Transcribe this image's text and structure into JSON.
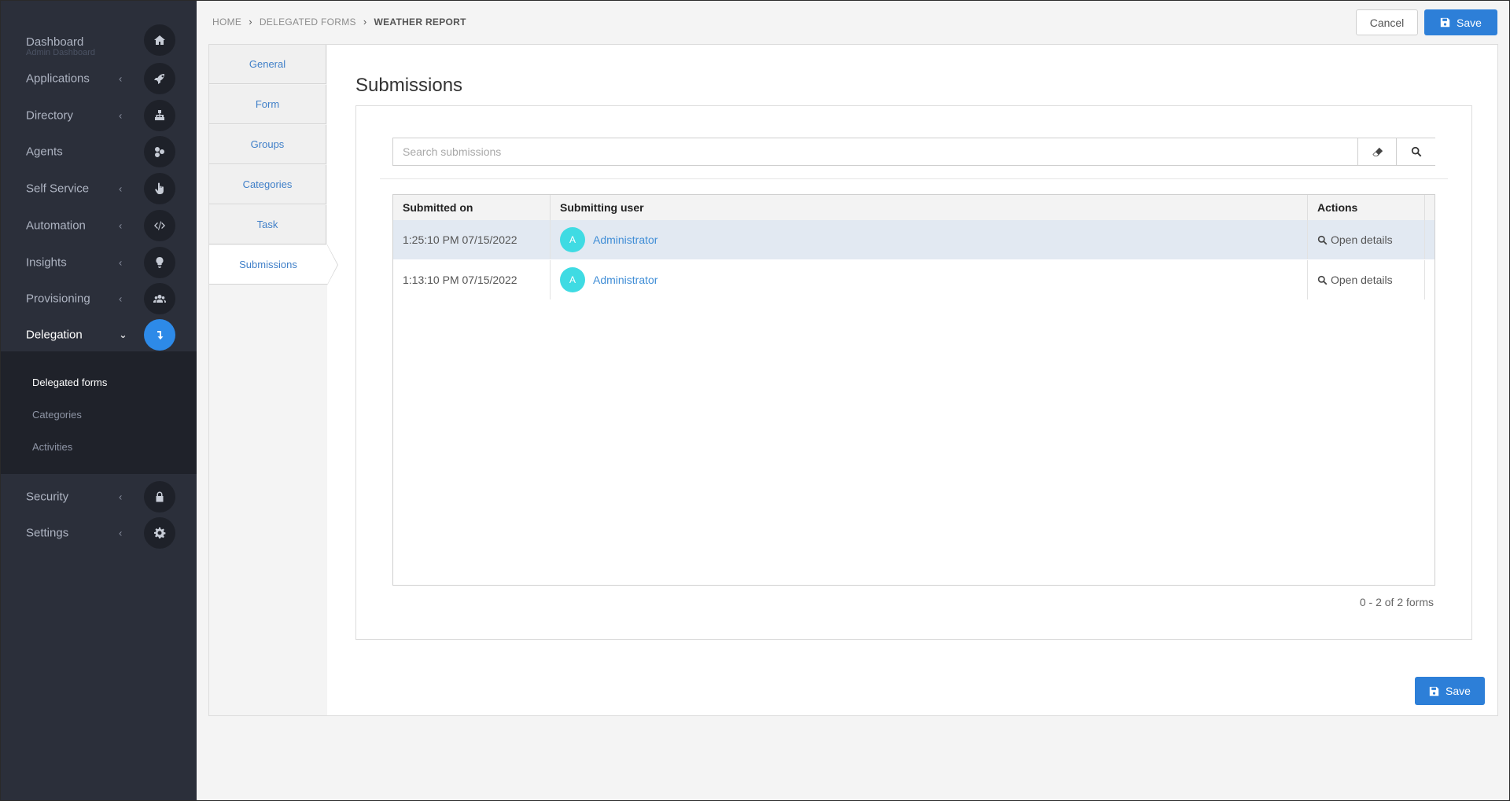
{
  "sidebar": {
    "items": [
      {
        "label": "Dashboard",
        "sub": "Admin Dashboard",
        "icon": "home-icon"
      },
      {
        "label": "Applications",
        "icon": "rocket-icon"
      },
      {
        "label": "Directory",
        "icon": "org-chart-icon"
      },
      {
        "label": "Agents",
        "icon": "agents-icon"
      },
      {
        "label": "Self Service",
        "icon": "hand-pointer-icon"
      },
      {
        "label": "Automation",
        "icon": "code-icon"
      },
      {
        "label": "Insights",
        "icon": "lightbulb-icon"
      },
      {
        "label": "Provisioning",
        "icon": "users-icon"
      },
      {
        "label": "Delegation",
        "icon": "level-down-icon"
      },
      {
        "label": "Security",
        "icon": "lock-icon"
      },
      {
        "label": "Settings",
        "icon": "gear-icon"
      }
    ],
    "subitems": [
      "Delegated forms",
      "Categories",
      "Activities"
    ],
    "chevron_left": "‹",
    "chevron_down": "⌄"
  },
  "header": {
    "breadcrumb": [
      "HOME",
      "DELEGATED FORMS",
      "WEATHER REPORT"
    ],
    "cancel_label": "Cancel",
    "save_label": "Save"
  },
  "tabs": [
    "General",
    "Form",
    "Groups",
    "Categories",
    "Task",
    "Submissions"
  ],
  "main": {
    "title": "Submissions",
    "search_placeholder": "Search submissions",
    "columns": [
      "Submitted on",
      "Submitting user",
      "Actions"
    ],
    "rows": [
      {
        "submitted_on": "1:25:10 PM 07/15/2022",
        "avatar": "A",
        "user": "Administrator",
        "action": "Open details"
      },
      {
        "submitted_on": "1:13:10 PM 07/15/2022",
        "avatar": "A",
        "user": "Administrator",
        "action": "Open details"
      }
    ],
    "pager": "0 - 2 of 2 forms",
    "save_label": "Save"
  },
  "colors": {
    "sidebar_bg": "#2b2f3a",
    "accent": "#2d7fd8",
    "link": "#3f8dd6",
    "avatar": "#3fdbe3"
  }
}
